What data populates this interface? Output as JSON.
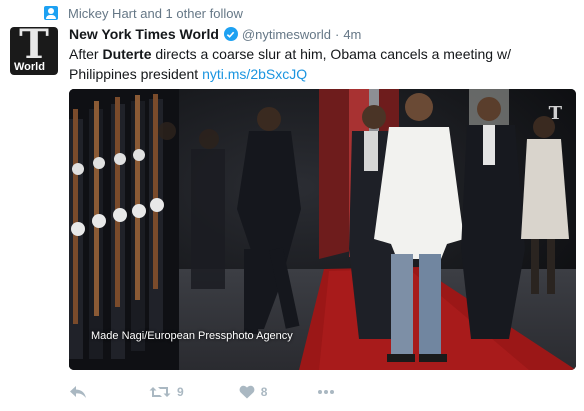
{
  "context": {
    "text": "Mickey Hart and 1 other follow"
  },
  "avatar": {
    "glyph": "T",
    "label": "World"
  },
  "tweet": {
    "name": "New York Times World",
    "handle": "@nytimesworld",
    "separator": "·",
    "time": "4m",
    "text_1": "After ",
    "text_2": "Duterte",
    "text_3": " directs a coarse slur at him, Obama cancels a meeting w/ Philippines president ",
    "link": "nyti.ms/2bSxcJQ"
  },
  "photo": {
    "credit": "Made Nagi/European Pressphoto Agency",
    "watermark": "T"
  },
  "actions": {
    "retweet_count": "9",
    "like_count": "8"
  }
}
